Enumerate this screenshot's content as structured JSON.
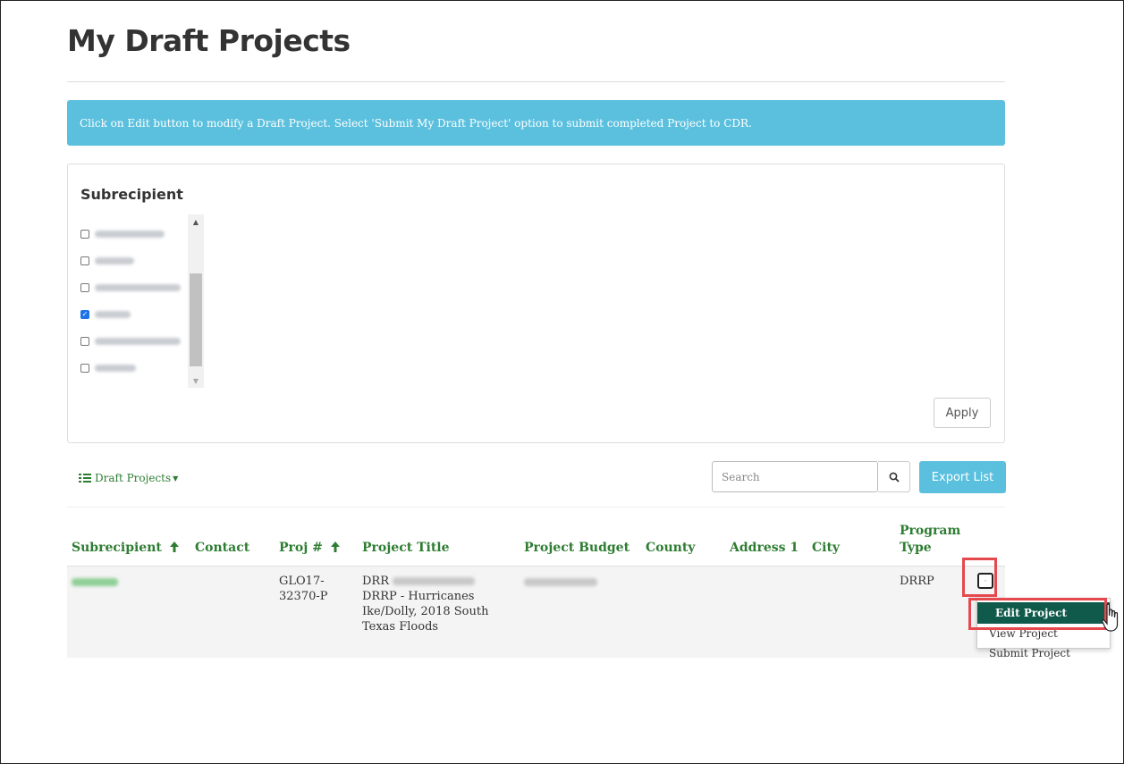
{
  "page": {
    "title": "My Draft Projects"
  },
  "banner": {
    "text": "Click on Edit button to modify a Draft Project. Select 'Submit My Draft Project' option to submit completed Project to CDR."
  },
  "filter": {
    "heading": "Subrecipient",
    "items": [
      {
        "checked": false
      },
      {
        "checked": false
      },
      {
        "checked": false
      },
      {
        "checked": true
      },
      {
        "checked": false
      },
      {
        "checked": false
      }
    ],
    "apply_label": "Apply"
  },
  "toolbar": {
    "view_menu_label": "Draft Projects",
    "search_placeholder": "Search",
    "export_label": "Export List"
  },
  "table": {
    "headers": {
      "subrecipient": "Subrecipient",
      "contact": "Contact",
      "proj_no": "Proj #",
      "project_title": "Project Title",
      "project_budget": "Project Budget",
      "county": "County",
      "address1": "Address 1",
      "city": "City",
      "program_type_1": "Program",
      "program_type_2": "Type"
    },
    "row": {
      "proj_no_1": "GLO17-",
      "proj_no_2": "32370-P",
      "title_prefix": "DRR",
      "title_line2": "DRRP - Hurricanes",
      "title_line3": "Ike/Dolly, 2018 South",
      "title_line4": "Texas Floods",
      "program_type": "DRRP"
    }
  },
  "action_menu": {
    "items": [
      "Edit Project",
      "View Project",
      "Submit Project"
    ]
  },
  "colors": {
    "accent_green": "#2e7d32",
    "info_blue": "#5bc0de",
    "menu_active": "#0f5a4b",
    "highlight_red": "#e5484d"
  }
}
